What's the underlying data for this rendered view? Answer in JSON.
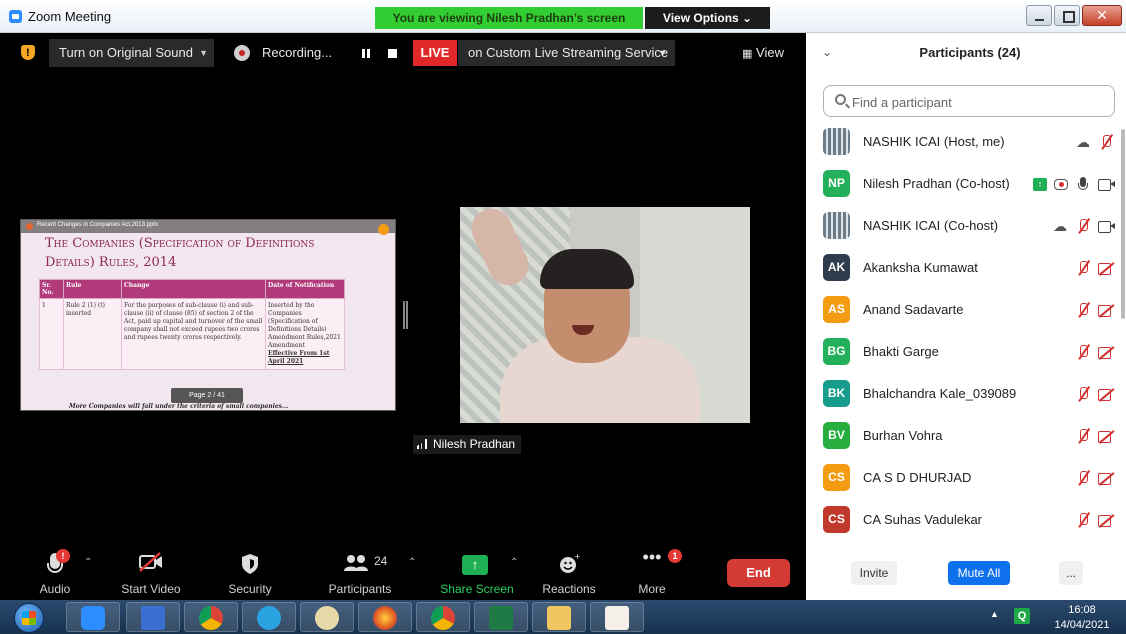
{
  "window": {
    "title": "Zoom Meeting",
    "viewing_banner": "You are viewing Nilesh Pradhan’s screen",
    "view_options": "View Options ⌄"
  },
  "topbar": {
    "original_sound": "Turn on Original Sound",
    "recording": "Recording...",
    "live": "LIVE",
    "live_service": "on Custom Live Streaming Service",
    "view": "View"
  },
  "shared_screen": {
    "file_name": "Recent Changes in Companies Act,2013.pptx",
    "slide_title": "The Companies (Specification of Definitions Details) Rules, 2014",
    "table_headers": [
      "Sr. No.",
      "Rule",
      "Change",
      "Date of Notification"
    ],
    "table_row": {
      "sr": "1",
      "rule": "Rule 2 (1) (t) inserted",
      "change": "For the purposes of sub-clause (i) and sub-clause (ii) of clause (85) of section 2 of the Act, paid up capital and turnover of the small company shall not exceed rupees two crores and rupees twenty crores respectively.",
      "date_lines": "Inserted by the Companies (Specification of Definitions Details) Amendment Rules,2021 Amendment",
      "date_bold": "Effective From 1st April 2021"
    },
    "page_indicator": "Page 2 / 41",
    "footer": "More Companies will fall under the criteria of small companies..."
  },
  "video": {
    "name": "Nilesh Pradhan"
  },
  "toolbar": {
    "audio": "Audio",
    "audio_badge": "!",
    "start_video": "Start Video",
    "security": "Security",
    "participants": "Participants",
    "participants_count": "24",
    "share_screen": "Share Screen",
    "reactions": "Reactions",
    "more": "More",
    "more_badge": "1",
    "end": "End"
  },
  "panel": {
    "title": "Participants (24)",
    "search_placeholder": "Find a participant",
    "participants": [
      {
        "initials": "",
        "name": "NASHIK ICAI (Host, me)",
        "color": "",
        "icons": [
          "cloud-record-icon",
          "mic-muted-icon"
        ]
      },
      {
        "initials": "NP",
        "name": "Nilesh Pradhan (Co-host)",
        "color": "#23b05a",
        "icons": [
          "screen-share-icon",
          "record-icon",
          "mic-icon",
          "camera-icon"
        ]
      },
      {
        "initials": "",
        "name": "NASHIK ICAI (Co-host)",
        "color": "",
        "icons": [
          "cloud-record-icon",
          "mic-muted-icon",
          "camera-icon"
        ]
      },
      {
        "initials": "AK",
        "name": "Akanksha Kumawat",
        "color": "#2f3d4f",
        "icons": [
          "mic-muted-icon",
          "camera-off-icon"
        ]
      },
      {
        "initials": "AS",
        "name": "Anand Sadavarte",
        "color": "#f39c12",
        "icons": [
          "mic-muted-icon",
          "camera-off-icon"
        ]
      },
      {
        "initials": "BG",
        "name": "Bhakti Garge",
        "color": "#23b05a",
        "icons": [
          "mic-muted-icon",
          "camera-off-icon"
        ]
      },
      {
        "initials": "BK",
        "name": "Bhalchandra Kale_039089",
        "color": "#169c8a",
        "icons": [
          "mic-muted-icon",
          "camera-off-icon"
        ]
      },
      {
        "initials": "BV",
        "name": "Burhan Vohra",
        "color": "#27ae3f",
        "icons": [
          "mic-muted-icon",
          "camera-off-icon"
        ]
      },
      {
        "initials": "CS",
        "name": "CA S D DHURJAD",
        "color": "#f39c12",
        "icons": [
          "mic-muted-icon",
          "camera-off-icon"
        ]
      },
      {
        "initials": "CS",
        "name": "CA Suhas Vadulekar",
        "color": "#c0392b",
        "icons": [
          "mic-muted-icon",
          "camera-off-icon"
        ]
      }
    ],
    "invite": "Invite",
    "mute_all": "Mute All",
    "more": "..."
  },
  "taskbar": {
    "clock_time": "16:08",
    "clock_date": "14/04/2021",
    "tray_q": "Q"
  }
}
